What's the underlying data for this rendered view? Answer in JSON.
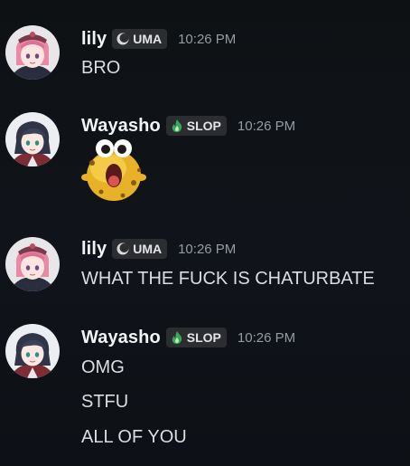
{
  "colors": {
    "background": "#0f1215",
    "text": "#dbdee1",
    "username": "#f2f3f5",
    "timestamp": "#949ba4",
    "tag_bg": "#2b2d31",
    "slop_icon": "#3ba55c"
  },
  "messages": [
    {
      "username": "lily",
      "tag": "UMA",
      "tag_icon": "moon-icon",
      "time": "10:26 PM",
      "lines": [
        "BRO"
      ]
    },
    {
      "username": "Wayasho",
      "tag": "SLOP",
      "tag_icon": "flame-icon",
      "time": "10:26 PM",
      "lines": [],
      "sticker": "yellow-blob-sticker"
    },
    {
      "username": "lily",
      "tag": "UMA",
      "tag_icon": "moon-icon",
      "time": "10:26 PM",
      "lines": [
        "WHAT THE FUCK IS CHATURBATE"
      ]
    },
    {
      "username": "Wayasho",
      "tag": "SLOP",
      "tag_icon": "flame-icon",
      "time": "10:26 PM",
      "lines": [
        "OMG",
        "STFU",
        "ALL OF YOU"
      ]
    }
  ]
}
